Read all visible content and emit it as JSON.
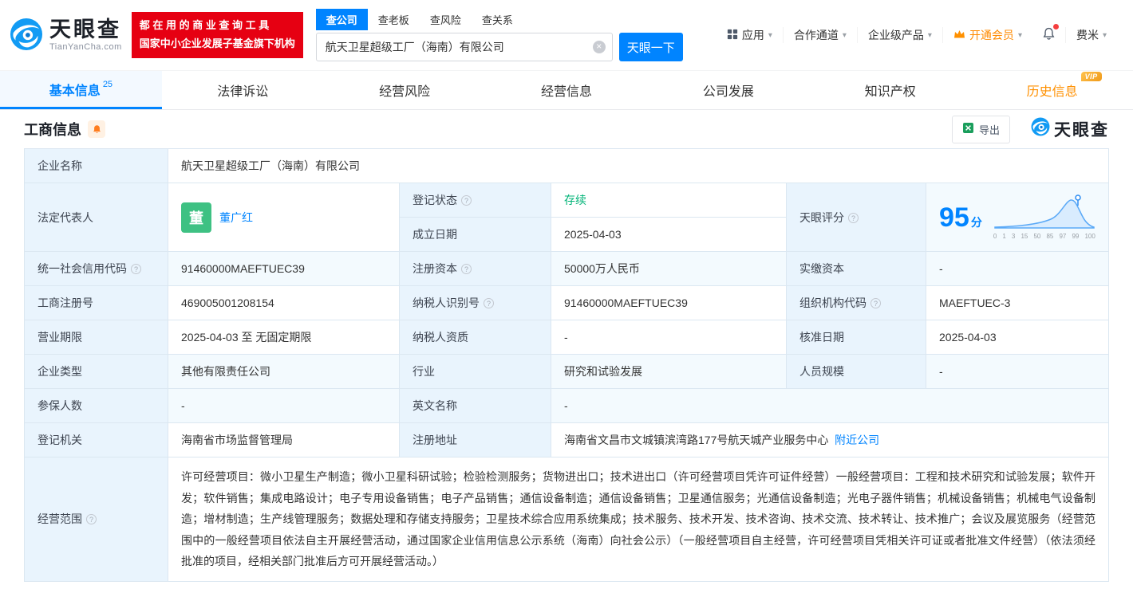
{
  "brand": {
    "name": "天眼查",
    "domain": "TianYanCha.com"
  },
  "slogan": {
    "line1": "都 在 用 的 商 业 查 询 工 具",
    "line2": "国家中小企业发展子基金旗下机构"
  },
  "search": {
    "tabs": [
      {
        "label": "查公司"
      },
      {
        "label": "查老板"
      },
      {
        "label": "查风险"
      },
      {
        "label": "查关系"
      }
    ],
    "value": "航天卫星超级工厂（海南）有限公司",
    "button": "天眼一下"
  },
  "nav": {
    "apps": "应用",
    "partner": "合作通道",
    "enterprise": "企业级产品",
    "vip": "开通会员",
    "user": "费米"
  },
  "tabs": [
    {
      "label": "基本信息",
      "count": "25"
    },
    {
      "label": "法律诉讼"
    },
    {
      "label": "经营风险"
    },
    {
      "label": "经营信息"
    },
    {
      "label": "公司发展"
    },
    {
      "label": "知识产权"
    },
    {
      "label": "历史信息",
      "badge": "VIP"
    }
  ],
  "section": {
    "title": "工商信息",
    "export": "导出",
    "brand": "天眼查"
  },
  "info": {
    "company_name": {
      "label": "企业名称",
      "value": "航天卫星超级工厂（海南）有限公司"
    },
    "legal_rep": {
      "label": "法定代表人",
      "avatar": "董",
      "name": "董广红"
    },
    "reg_status": {
      "label": "登记状态",
      "value": "存续"
    },
    "established": {
      "label": "成立日期",
      "value": "2025-04-03"
    },
    "score": {
      "label": "天眼评分",
      "value": "95",
      "unit": "分",
      "ticks": [
        "0",
        "1",
        "3",
        "15",
        "50",
        "85",
        "97",
        "99",
        "100"
      ]
    },
    "credit_code": {
      "label": "统一社会信用代码",
      "value": "91460000MAEFTUEC39"
    },
    "reg_capital": {
      "label": "注册资本",
      "value": "50000万人民币"
    },
    "paid_capital": {
      "label": "实缴资本",
      "value": "-"
    },
    "reg_number": {
      "label": "工商注册号",
      "value": "469005001208154"
    },
    "taxpayer_id": {
      "label": "纳税人识别号",
      "value": "91460000MAEFTUEC39"
    },
    "org_code": {
      "label": "组织机构代码",
      "value": "MAEFTUEC-3"
    },
    "business_term": {
      "label": "营业期限",
      "value": "2025-04-03 至 无固定期限"
    },
    "taxpayer_quality": {
      "label": "纳税人资质",
      "value": "-"
    },
    "approval_date": {
      "label": "核准日期",
      "value": "2025-04-03"
    },
    "company_type": {
      "label": "企业类型",
      "value": "其他有限责任公司"
    },
    "industry": {
      "label": "行业",
      "value": "研究和试验发展"
    },
    "staff_size": {
      "label": "人员规模",
      "value": "-"
    },
    "insured": {
      "label": "参保人数",
      "value": "-"
    },
    "english_name": {
      "label": "英文名称",
      "value": "-"
    },
    "reg_authority": {
      "label": "登记机关",
      "value": "海南省市场监督管理局"
    },
    "address": {
      "label": "注册地址",
      "value": "海南省文昌市文城镇滨湾路177号航天城产业服务中心",
      "link": "附近公司"
    },
    "scope": {
      "label": "经营范围",
      "value": "许可经营项目：微小卫星生产制造；微小卫星科研试验；检验检测服务；货物进出口；技术进出口（许可经营项目凭许可证件经营）一般经营项目：工程和技术研究和试验发展；软件开发；软件销售；集成电路设计；电子专用设备销售；电子产品销售；通信设备制造；通信设备销售；卫星通信服务；光通信设备制造；光电子器件销售；机械设备销售；机械电气设备制造；增材制造；生产线管理服务；数据处理和存储支持服务；卫星技术综合应用系统集成；技术服务、技术开发、技术咨询、技术交流、技术转让、技术推广；会议及展览服务（经营范围中的一般经营项目依法自主开展经营活动，通过国家企业信用信息公示系统（海南）向社会公示）（一般经营项目自主经营，许可经营项目凭相关许可证或者批准文件经营）（依法须经批准的项目，经相关部门批准后方可开展经营活动。）"
    }
  },
  "icons": {
    "clear": "×",
    "caret": "▾",
    "help": "?"
  },
  "colors": {
    "accent": "#0084ff",
    "green": "#00b377",
    "orange": "#ff9000",
    "red": "#e60012"
  }
}
